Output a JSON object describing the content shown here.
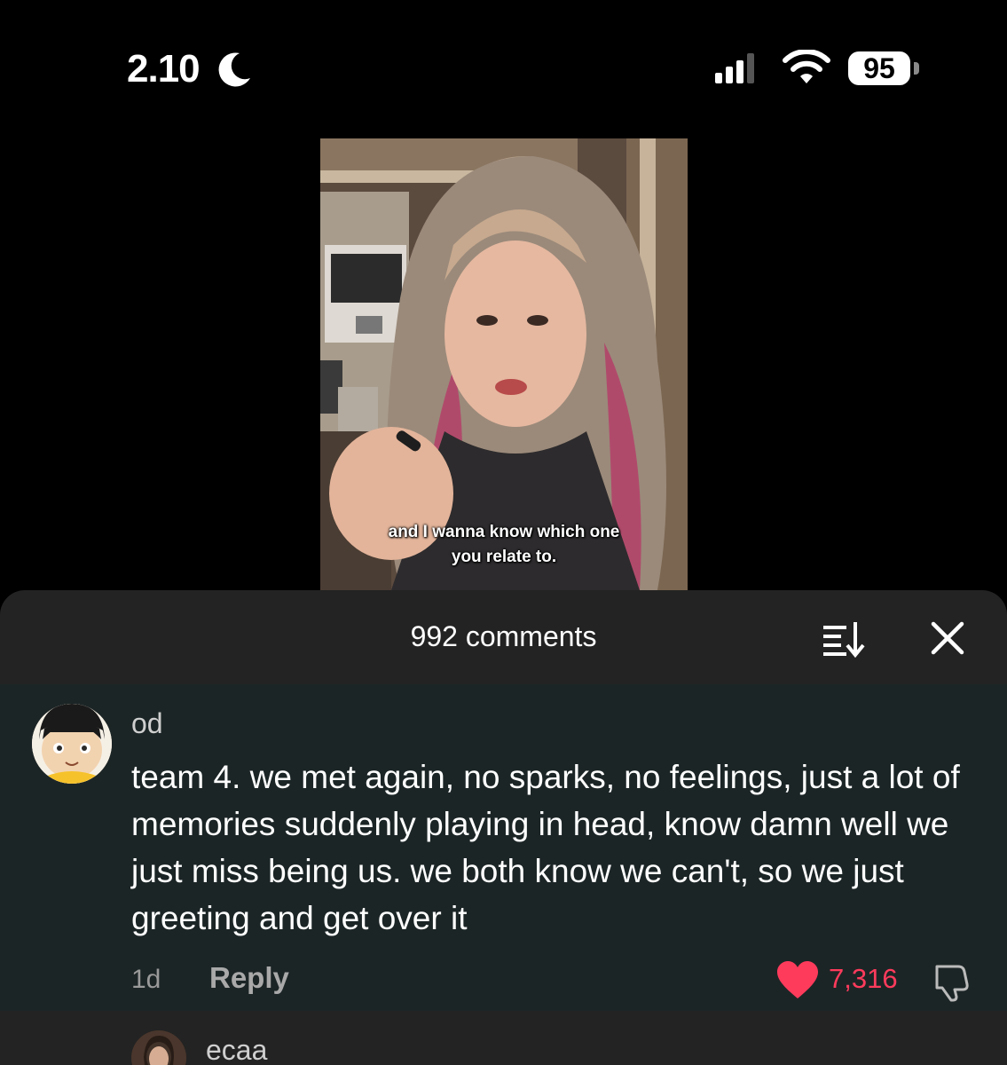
{
  "status_bar": {
    "time": "2.10",
    "battery": "95"
  },
  "video": {
    "caption_line1": "and I wanna know which one",
    "caption_line2": "you relate to."
  },
  "comments_sheet": {
    "count_label": "992 comments",
    "comments": [
      {
        "username": "od",
        "text": "team 4. we met again, no sparks, no feelings, just a lot of memories suddenly playing in head, know damn well we just miss being us. we both know we can't, so we just greeting and get over it",
        "age": "1d",
        "reply_label": "Reply",
        "likes": "7,316"
      },
      {
        "username": "ecaa"
      }
    ]
  },
  "colors": {
    "like": "#ff3b5c",
    "sheet_bg": "#232323",
    "comment_bg": "#1c2526"
  }
}
